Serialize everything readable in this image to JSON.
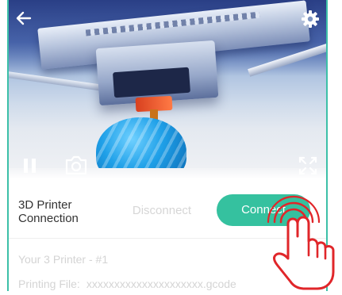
{
  "video": {
    "icons": {
      "back": "back-arrow-icon",
      "settings": "gear-icon",
      "pause": "pause-icon",
      "snapshot": "camera-icon",
      "fullscreen": "fullscreen-icon"
    }
  },
  "panel": {
    "title": "3D Printer Connection",
    "disconnect_label": "Disconnect",
    "connect_label": "Connect",
    "printer_name": "Your 3 Printer - #1",
    "printing_file_label": "Printing File:",
    "printing_file_value": "xxxxxxxxxxxxxxxxxxxxx.gcode"
  },
  "colors": {
    "accent": "#35c19f",
    "frame_border": "#3cc0a8",
    "muted_text": "#d4d4d4",
    "hand_outline": "#e0262a"
  }
}
